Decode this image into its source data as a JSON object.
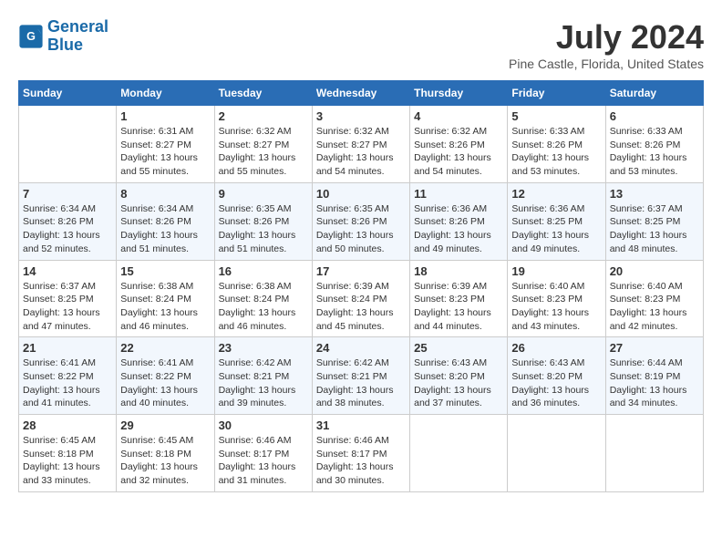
{
  "header": {
    "logo_line1": "General",
    "logo_line2": "Blue",
    "month": "July 2024",
    "location": "Pine Castle, Florida, United States"
  },
  "days_of_week": [
    "Sunday",
    "Monday",
    "Tuesday",
    "Wednesday",
    "Thursday",
    "Friday",
    "Saturday"
  ],
  "weeks": [
    [
      {
        "day": "",
        "sunrise": "",
        "sunset": "",
        "daylight": ""
      },
      {
        "day": "1",
        "sunrise": "Sunrise: 6:31 AM",
        "sunset": "Sunset: 8:27 PM",
        "daylight": "Daylight: 13 hours and 55 minutes."
      },
      {
        "day": "2",
        "sunrise": "Sunrise: 6:32 AM",
        "sunset": "Sunset: 8:27 PM",
        "daylight": "Daylight: 13 hours and 55 minutes."
      },
      {
        "day": "3",
        "sunrise": "Sunrise: 6:32 AM",
        "sunset": "Sunset: 8:27 PM",
        "daylight": "Daylight: 13 hours and 54 minutes."
      },
      {
        "day": "4",
        "sunrise": "Sunrise: 6:32 AM",
        "sunset": "Sunset: 8:26 PM",
        "daylight": "Daylight: 13 hours and 54 minutes."
      },
      {
        "day": "5",
        "sunrise": "Sunrise: 6:33 AM",
        "sunset": "Sunset: 8:26 PM",
        "daylight": "Daylight: 13 hours and 53 minutes."
      },
      {
        "day": "6",
        "sunrise": "Sunrise: 6:33 AM",
        "sunset": "Sunset: 8:26 PM",
        "daylight": "Daylight: 13 hours and 53 minutes."
      }
    ],
    [
      {
        "day": "7",
        "sunrise": "Sunrise: 6:34 AM",
        "sunset": "Sunset: 8:26 PM",
        "daylight": "Daylight: 13 hours and 52 minutes."
      },
      {
        "day": "8",
        "sunrise": "Sunrise: 6:34 AM",
        "sunset": "Sunset: 8:26 PM",
        "daylight": "Daylight: 13 hours and 51 minutes."
      },
      {
        "day": "9",
        "sunrise": "Sunrise: 6:35 AM",
        "sunset": "Sunset: 8:26 PM",
        "daylight": "Daylight: 13 hours and 51 minutes."
      },
      {
        "day": "10",
        "sunrise": "Sunrise: 6:35 AM",
        "sunset": "Sunset: 8:26 PM",
        "daylight": "Daylight: 13 hours and 50 minutes."
      },
      {
        "day": "11",
        "sunrise": "Sunrise: 6:36 AM",
        "sunset": "Sunset: 8:26 PM",
        "daylight": "Daylight: 13 hours and 49 minutes."
      },
      {
        "day": "12",
        "sunrise": "Sunrise: 6:36 AM",
        "sunset": "Sunset: 8:25 PM",
        "daylight": "Daylight: 13 hours and 49 minutes."
      },
      {
        "day": "13",
        "sunrise": "Sunrise: 6:37 AM",
        "sunset": "Sunset: 8:25 PM",
        "daylight": "Daylight: 13 hours and 48 minutes."
      }
    ],
    [
      {
        "day": "14",
        "sunrise": "Sunrise: 6:37 AM",
        "sunset": "Sunset: 8:25 PM",
        "daylight": "Daylight: 13 hours and 47 minutes."
      },
      {
        "day": "15",
        "sunrise": "Sunrise: 6:38 AM",
        "sunset": "Sunset: 8:24 PM",
        "daylight": "Daylight: 13 hours and 46 minutes."
      },
      {
        "day": "16",
        "sunrise": "Sunrise: 6:38 AM",
        "sunset": "Sunset: 8:24 PM",
        "daylight": "Daylight: 13 hours and 46 minutes."
      },
      {
        "day": "17",
        "sunrise": "Sunrise: 6:39 AM",
        "sunset": "Sunset: 8:24 PM",
        "daylight": "Daylight: 13 hours and 45 minutes."
      },
      {
        "day": "18",
        "sunrise": "Sunrise: 6:39 AM",
        "sunset": "Sunset: 8:23 PM",
        "daylight": "Daylight: 13 hours and 44 minutes."
      },
      {
        "day": "19",
        "sunrise": "Sunrise: 6:40 AM",
        "sunset": "Sunset: 8:23 PM",
        "daylight": "Daylight: 13 hours and 43 minutes."
      },
      {
        "day": "20",
        "sunrise": "Sunrise: 6:40 AM",
        "sunset": "Sunset: 8:23 PM",
        "daylight": "Daylight: 13 hours and 42 minutes."
      }
    ],
    [
      {
        "day": "21",
        "sunrise": "Sunrise: 6:41 AM",
        "sunset": "Sunset: 8:22 PM",
        "daylight": "Daylight: 13 hours and 41 minutes."
      },
      {
        "day": "22",
        "sunrise": "Sunrise: 6:41 AM",
        "sunset": "Sunset: 8:22 PM",
        "daylight": "Daylight: 13 hours and 40 minutes."
      },
      {
        "day": "23",
        "sunrise": "Sunrise: 6:42 AM",
        "sunset": "Sunset: 8:21 PM",
        "daylight": "Daylight: 13 hours and 39 minutes."
      },
      {
        "day": "24",
        "sunrise": "Sunrise: 6:42 AM",
        "sunset": "Sunset: 8:21 PM",
        "daylight": "Daylight: 13 hours and 38 minutes."
      },
      {
        "day": "25",
        "sunrise": "Sunrise: 6:43 AM",
        "sunset": "Sunset: 8:20 PM",
        "daylight": "Daylight: 13 hours and 37 minutes."
      },
      {
        "day": "26",
        "sunrise": "Sunrise: 6:43 AM",
        "sunset": "Sunset: 8:20 PM",
        "daylight": "Daylight: 13 hours and 36 minutes."
      },
      {
        "day": "27",
        "sunrise": "Sunrise: 6:44 AM",
        "sunset": "Sunset: 8:19 PM",
        "daylight": "Daylight: 13 hours and 34 minutes."
      }
    ],
    [
      {
        "day": "28",
        "sunrise": "Sunrise: 6:45 AM",
        "sunset": "Sunset: 8:18 PM",
        "daylight": "Daylight: 13 hours and 33 minutes."
      },
      {
        "day": "29",
        "sunrise": "Sunrise: 6:45 AM",
        "sunset": "Sunset: 8:18 PM",
        "daylight": "Daylight: 13 hours and 32 minutes."
      },
      {
        "day": "30",
        "sunrise": "Sunrise: 6:46 AM",
        "sunset": "Sunset: 8:17 PM",
        "daylight": "Daylight: 13 hours and 31 minutes."
      },
      {
        "day": "31",
        "sunrise": "Sunrise: 6:46 AM",
        "sunset": "Sunset: 8:17 PM",
        "daylight": "Daylight: 13 hours and 30 minutes."
      },
      {
        "day": "",
        "sunrise": "",
        "sunset": "",
        "daylight": ""
      },
      {
        "day": "",
        "sunrise": "",
        "sunset": "",
        "daylight": ""
      },
      {
        "day": "",
        "sunrise": "",
        "sunset": "",
        "daylight": ""
      }
    ]
  ]
}
